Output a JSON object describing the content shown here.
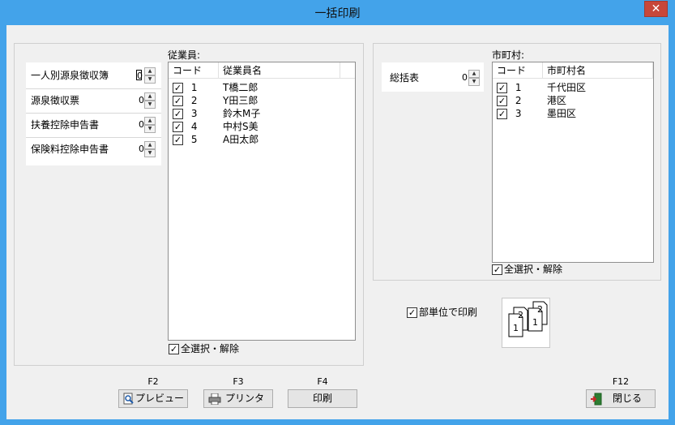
{
  "window": {
    "title": "一括印刷",
    "close_glyph": "✕"
  },
  "left_forms": [
    {
      "label": "一人別源泉徴収簿",
      "count": "0"
    },
    {
      "label": "源泉徴収票",
      "count": "0"
    },
    {
      "label": "扶養控除申告書",
      "count": "0"
    },
    {
      "label": "保険料控除申告書",
      "count": "0"
    }
  ],
  "employees": {
    "section_label": "従業員:",
    "col_code": "コード",
    "col_name": "従業員名",
    "rows": [
      {
        "code": "1",
        "name": "T橋二郎"
      },
      {
        "code": "2",
        "name": "Y田三郎"
      },
      {
        "code": "3",
        "name": "鈴木M子"
      },
      {
        "code": "4",
        "name": "中村S美"
      },
      {
        "code": "5",
        "name": "A田太郎"
      }
    ],
    "select_all": "全選択・解除"
  },
  "summary": {
    "label": "総括表",
    "count": "0"
  },
  "municipalities": {
    "section_label": "市町村:",
    "col_code": "コード",
    "col_name": "市町村名",
    "rows": [
      {
        "code": "1",
        "name": "千代田区"
      },
      {
        "code": "2",
        "name": "港区"
      },
      {
        "code": "3",
        "name": "墨田区"
      }
    ],
    "select_all": "全選択・解除"
  },
  "dept_print": {
    "label": "部単位で印刷",
    "checked": true
  },
  "collate_icon": {
    "top": "2",
    "bottom": "1"
  },
  "buttons": {
    "preview": {
      "key": "F2",
      "label": "プレビュー"
    },
    "printer": {
      "key": "F3",
      "label": "プリンタ"
    },
    "print": {
      "key": "F4",
      "label": "印刷"
    },
    "close": {
      "key": "F12",
      "label": "閉じる"
    }
  },
  "check_glyph": "✓"
}
